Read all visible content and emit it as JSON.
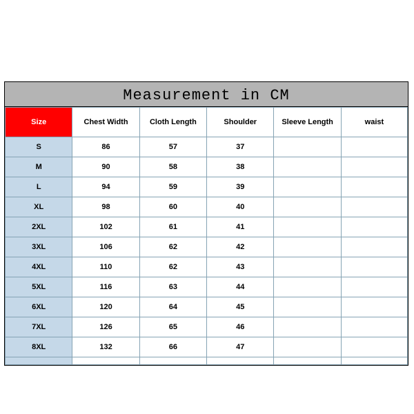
{
  "chart_data": {
    "type": "table",
    "title": "Measurement in CM",
    "columns": [
      "Size",
      "Chest Width",
      "Cloth Length",
      "Shoulder",
      "Sleeve Length",
      "waist"
    ],
    "rows": [
      {
        "size": "S",
        "chest_width": 86,
        "cloth_length": 57,
        "shoulder": 37,
        "sleeve_length": "",
        "waist": ""
      },
      {
        "size": "M",
        "chest_width": 90,
        "cloth_length": 58,
        "shoulder": 38,
        "sleeve_length": "",
        "waist": ""
      },
      {
        "size": "L",
        "chest_width": 94,
        "cloth_length": 59,
        "shoulder": 39,
        "sleeve_length": "",
        "waist": ""
      },
      {
        "size": "XL",
        "chest_width": 98,
        "cloth_length": 60,
        "shoulder": 40,
        "sleeve_length": "",
        "waist": ""
      },
      {
        "size": "2XL",
        "chest_width": 102,
        "cloth_length": 61,
        "shoulder": 41,
        "sleeve_length": "",
        "waist": ""
      },
      {
        "size": "3XL",
        "chest_width": 106,
        "cloth_length": 62,
        "shoulder": 42,
        "sleeve_length": "",
        "waist": ""
      },
      {
        "size": "4XL",
        "chest_width": 110,
        "cloth_length": 62,
        "shoulder": 43,
        "sleeve_length": "",
        "waist": ""
      },
      {
        "size": "5XL",
        "chest_width": 116,
        "cloth_length": 63,
        "shoulder": 44,
        "sleeve_length": "",
        "waist": ""
      },
      {
        "size": "6XL",
        "chest_width": 120,
        "cloth_length": 64,
        "shoulder": 45,
        "sleeve_length": "",
        "waist": ""
      },
      {
        "size": "7XL",
        "chest_width": 126,
        "cloth_length": 65,
        "shoulder": 46,
        "sleeve_length": "",
        "waist": ""
      },
      {
        "size": "8XL",
        "chest_width": 132,
        "cloth_length": 66,
        "shoulder": 47,
        "sleeve_length": "",
        "waist": ""
      }
    ]
  }
}
